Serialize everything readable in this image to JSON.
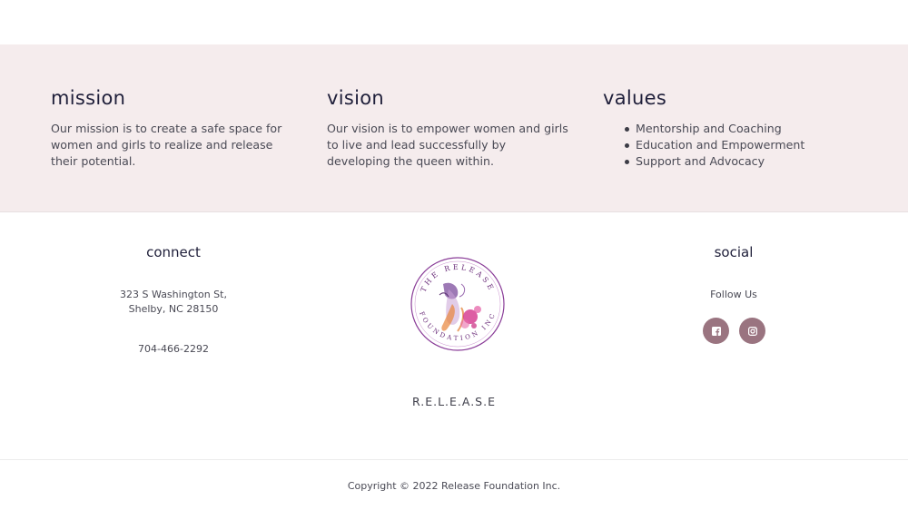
{
  "mission": {
    "title": "mission",
    "text": "Our mission is to create a safe space for women and girls to realize and release their potential."
  },
  "vision": {
    "title": "vision",
    "text": "Our vision is to empower women and girls to live and lead successfully by developing the queen within."
  },
  "values": {
    "title": "values",
    "items": [
      "Mentorship and Coaching",
      "Education and Empowerment",
      "Support and Advocacy"
    ]
  },
  "connect": {
    "title": "connect",
    "address_line1": "323 S Washington St,",
    "address_line2": "Shelby, NC 28150",
    "phone": "704-466-2292"
  },
  "logo": {
    "arc_text_top": "THE RELEASE",
    "arc_text_bottom": "FOUNDATION INC",
    "brand_name": "R.E.L.E.A.S.E"
  },
  "social": {
    "title": "social",
    "follow_label": "Follow Us",
    "icons": [
      "facebook-icon",
      "instagram-icon"
    ],
    "button_color": "#9a7480"
  },
  "footer": {
    "copyright": "Copyright © 2022 Release Foundation Inc."
  },
  "colors": {
    "band_background": "#f5eced",
    "heading": "#1f1f3a",
    "logo_purple": "#8a3d98",
    "logo_pink": "#d4358c"
  }
}
